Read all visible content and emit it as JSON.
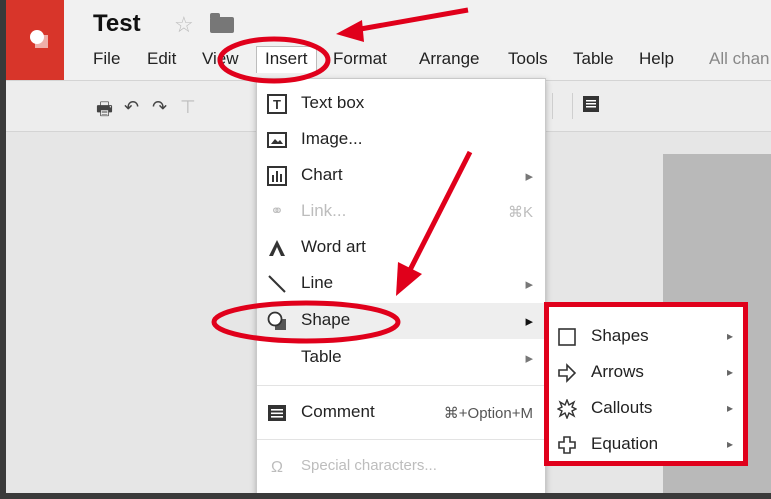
{
  "doc": {
    "title": "Test"
  },
  "menubar": {
    "items": [
      "File",
      "Edit",
      "View",
      "Insert",
      "Format",
      "Arrange",
      "Tools",
      "Table",
      "Help"
    ],
    "status": "All chan"
  },
  "toolbar": {
    "icons": [
      "print-icon",
      "undo-icon",
      "redo-icon",
      "paint-format-icon",
      "comment-icon"
    ]
  },
  "insert_menu": {
    "items": [
      {
        "label": "Text box",
        "icon": "text-box-icon",
        "shortcut": "",
        "disabled": false
      },
      {
        "label": "Image...",
        "icon": "image-icon",
        "shortcut": "",
        "disabled": false
      },
      {
        "label": "Chart",
        "icon": "chart-icon",
        "shortcut": "▸",
        "disabled": false
      },
      {
        "label": "Link...",
        "icon": "link-icon",
        "shortcut": "⌘K",
        "disabled": true
      },
      {
        "label": "Word art",
        "icon": "word-art-icon",
        "shortcut": "",
        "disabled": false
      },
      {
        "label": "Line",
        "icon": "line-icon",
        "shortcut": "▸",
        "disabled": false
      },
      {
        "label": "Shape",
        "icon": "shape-icon",
        "shortcut": "▸",
        "disabled": false
      },
      {
        "label": "Table",
        "icon": "",
        "shortcut": "▸",
        "disabled": false
      },
      {
        "label": "Comment",
        "icon": "comment-icon",
        "shortcut": "⌘+Option+M",
        "disabled": false
      },
      {
        "label": "Special characters...",
        "icon": "omega-icon",
        "shortcut": "",
        "disabled": true
      }
    ]
  },
  "shape_submenu": {
    "items": [
      {
        "label": "Shapes",
        "icon": "square-icon"
      },
      {
        "label": "Arrows",
        "icon": "arrow-icon"
      },
      {
        "label": "Callouts",
        "icon": "callout-icon"
      },
      {
        "label": "Equation",
        "icon": "plus-icon"
      }
    ]
  },
  "colors": {
    "brand": "#d8352a",
    "annotation": "#e0001b"
  }
}
